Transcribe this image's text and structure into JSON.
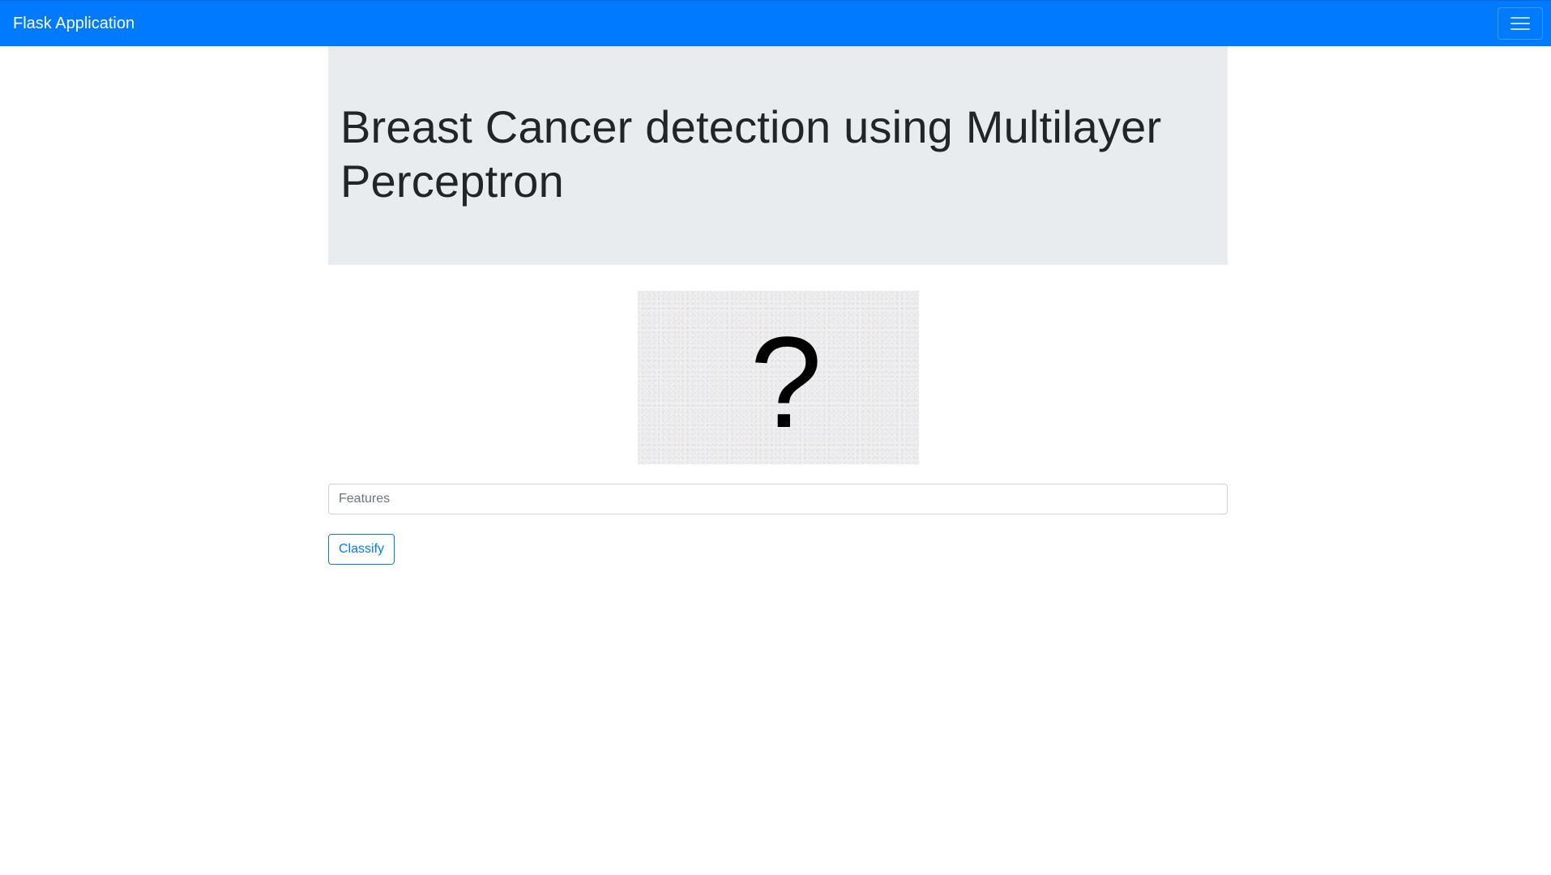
{
  "navbar": {
    "brand": "Flask Application",
    "menu_icon": "hamburger-menu-icon",
    "background_color": "#007bff"
  },
  "jumbotron": {
    "title": "Breast Cancer detection using Multilayer Perceptron",
    "background_color": "#e9ecef"
  },
  "image": {
    "icon": "question-mark-icon",
    "glyph": "?"
  },
  "form": {
    "features_placeholder": "Features",
    "features_value": "",
    "classify_label": "Classify",
    "accent_color": "#007bff"
  }
}
